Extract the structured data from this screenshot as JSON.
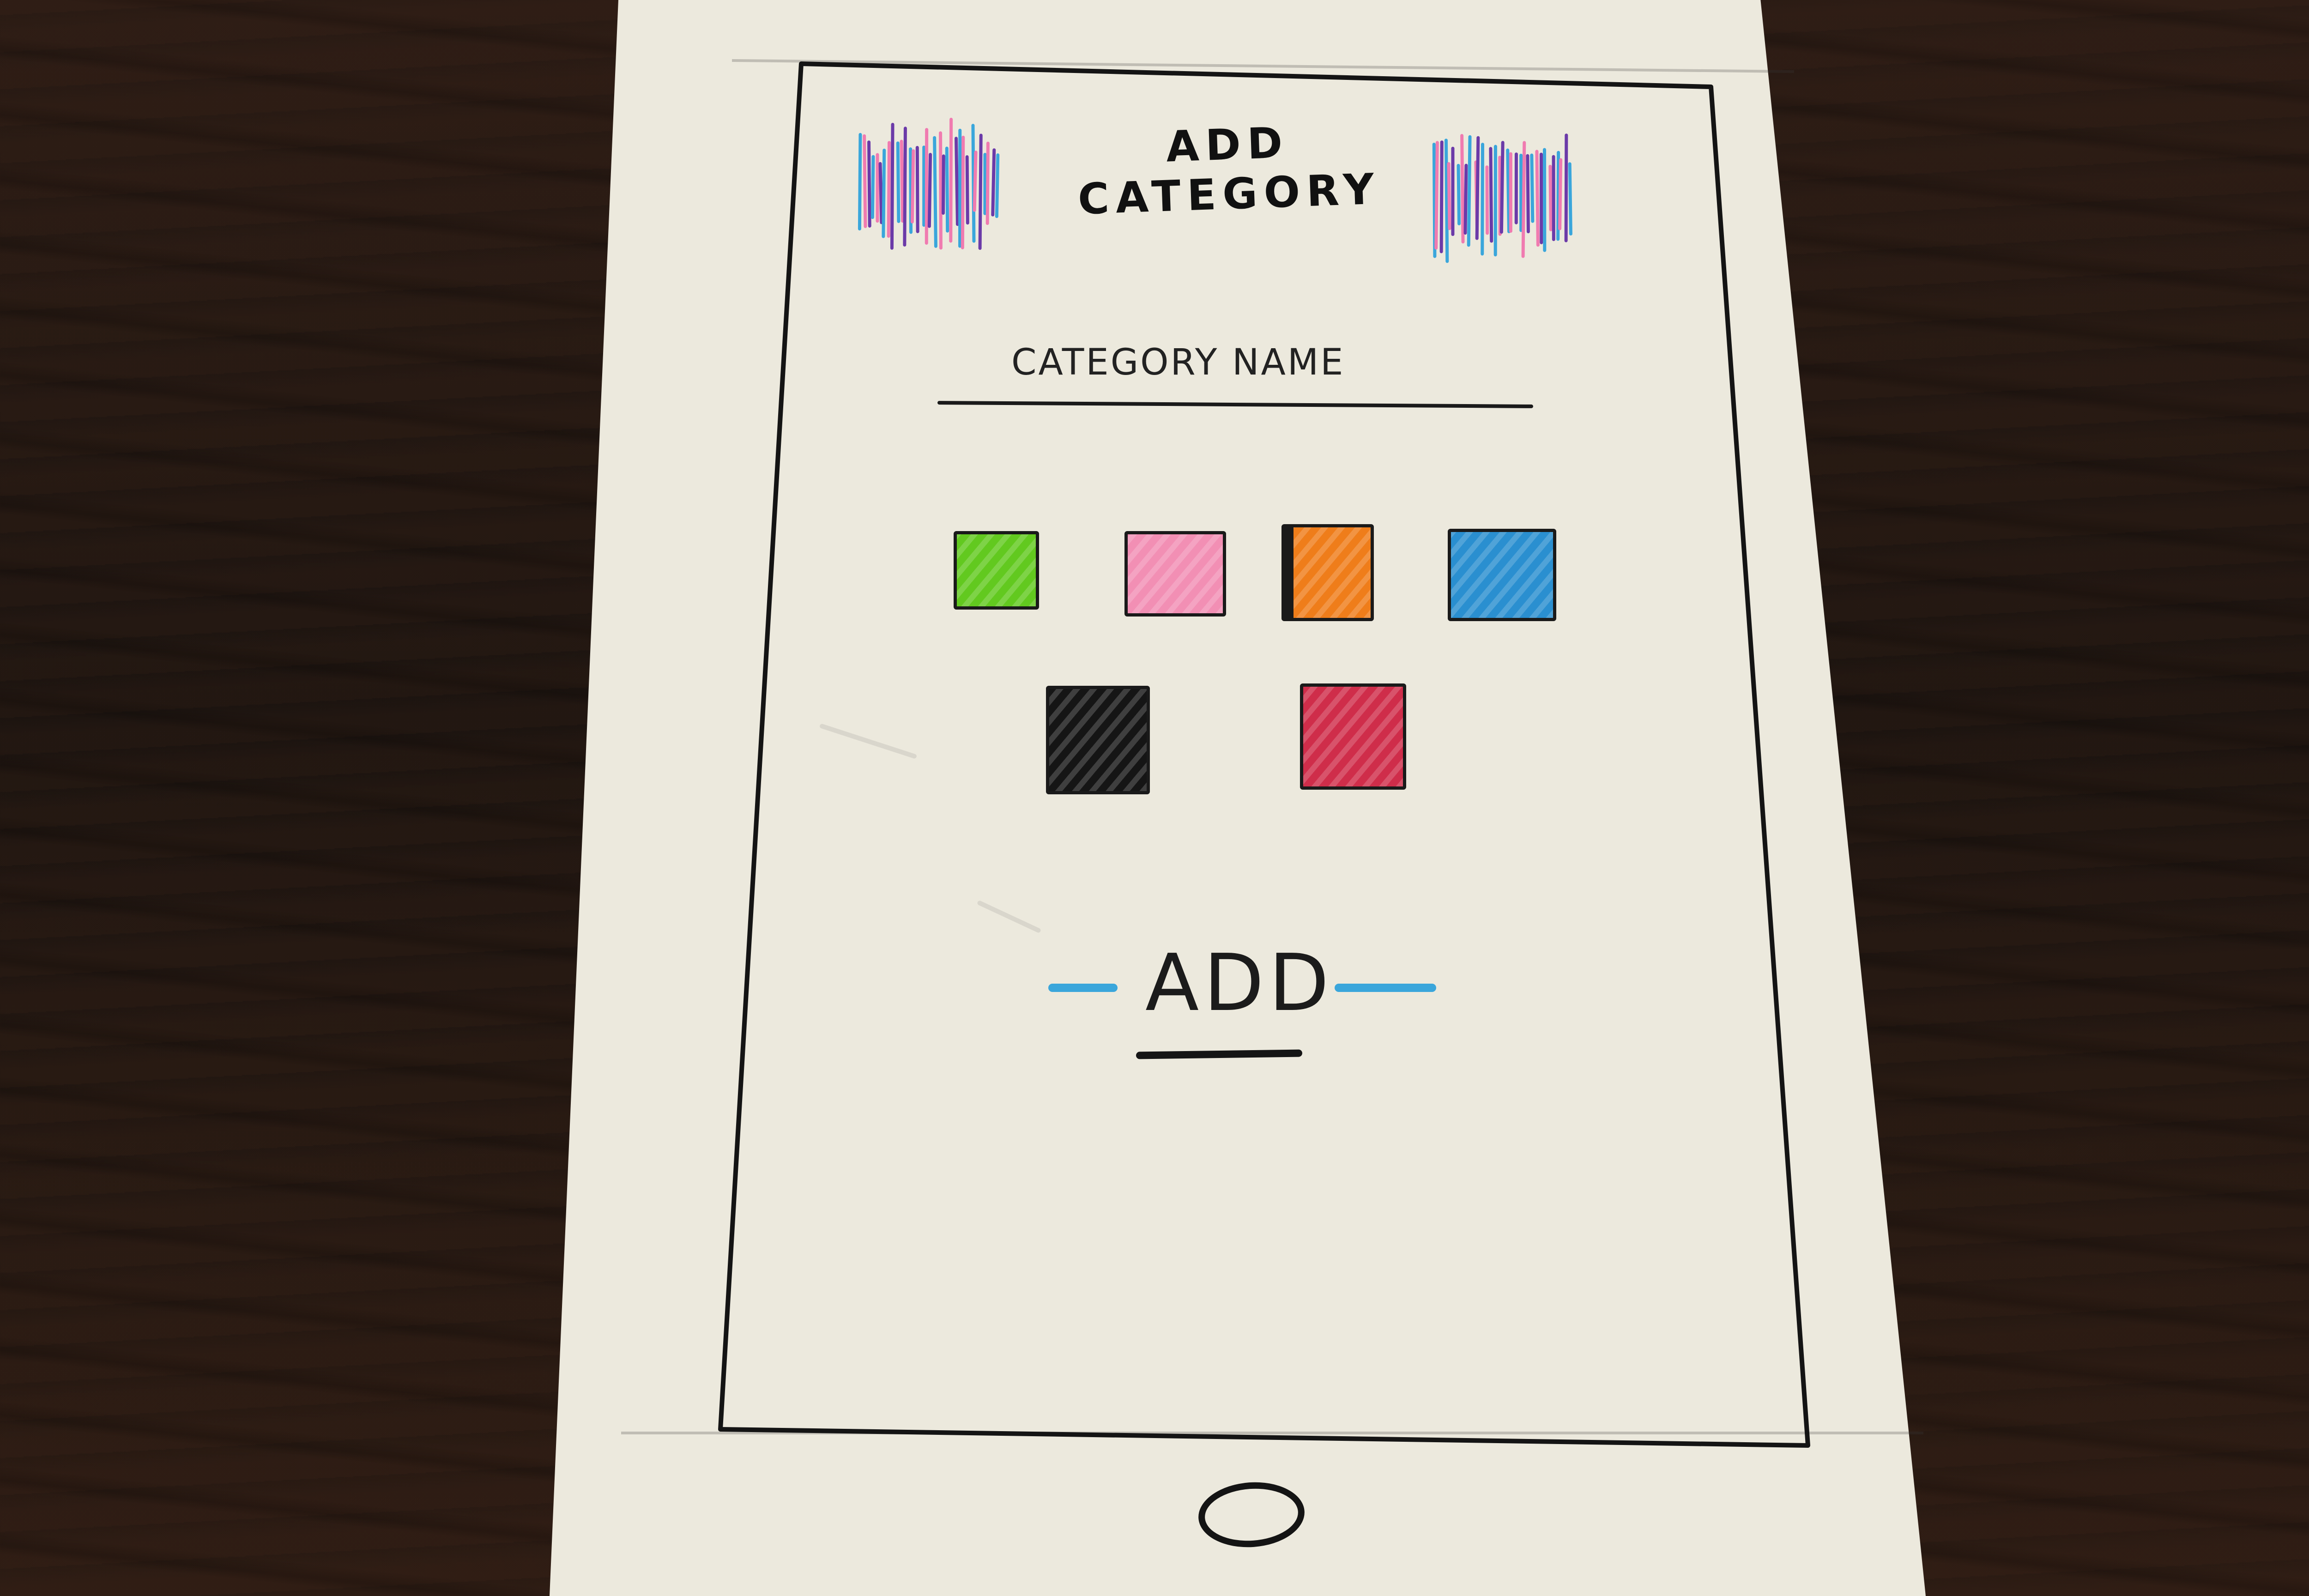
{
  "screen": {
    "title": "ADD CATEGORY",
    "name_field": {
      "placeholder": "CATEGORY NAME",
      "value": ""
    },
    "color_options": [
      {
        "id": "green",
        "color": "#62c91f",
        "selected": false
      },
      {
        "id": "pink",
        "color": "#f28fb4",
        "selected": false
      },
      {
        "id": "orange",
        "color": "#ef7d1a",
        "selected": true
      },
      {
        "id": "blue",
        "color": "#2a8fd0",
        "selected": false
      },
      {
        "id": "black",
        "color": "#151515",
        "selected": false
      },
      {
        "id": "red",
        "color": "#cf2d4a",
        "selected": false
      }
    ],
    "add_button": {
      "label": "ADD",
      "accent_color": "#3aa6db"
    }
  },
  "decoration": {
    "scribble_colors": [
      "#3aa6db",
      "#f07bb0",
      "#6b3aa8"
    ]
  },
  "device": {
    "home_button_icon": "home-button-icon"
  }
}
